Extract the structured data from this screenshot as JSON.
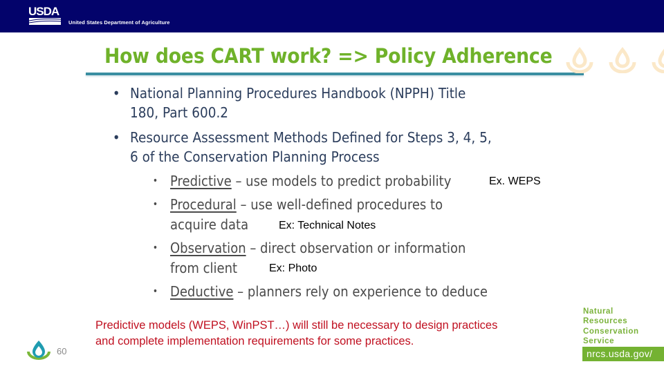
{
  "header": {
    "logo_text": "USDA",
    "department": "United States Department of Agriculture",
    "background_color": "#03036b"
  },
  "slide": {
    "title": "How does CART work? => Policy Adherence",
    "title_color": "#6fb22a",
    "bullets": [
      {
        "lines": [
          "National Planning Procedures Handbook (NPPH) Title",
          "180, Part 600.2"
        ]
      },
      {
        "lines": [
          "Resource Assessment Methods Defined for Steps 3, 4, 5,",
          "6 of the Conservation Planning Process"
        ]
      }
    ],
    "methods": [
      {
        "term": "Predictive",
        "rest_line1": " – use models to predict probability",
        "rest_line2": "",
        "example": "Ex. WEPS"
      },
      {
        "term": "Procedural",
        "rest_line1": " – use well-defined procedures to",
        "rest_line2": "acquire data",
        "example": "Ex: Technical Notes"
      },
      {
        "term": "Observation",
        "rest_line1": " – direct observation or information",
        "rest_line2": "from client",
        "example": "Ex: Photo"
      },
      {
        "term": "Deductive",
        "rest_line1": " – planners rely on experience to deduce",
        "rest_line2": "",
        "example": ""
      }
    ],
    "note_lines": [
      "Predictive models (WEPS, WinPST…) will still be necessary to design practices",
      "and complete implementation requirements for some practices."
    ],
    "note_color": "#c01020"
  },
  "footer": {
    "page_number": "60",
    "agency_lines": [
      "Natural",
      "Resources",
      "Conservation",
      "Service"
    ],
    "url": "nrcs.usda.gov/",
    "accent_color": "#74b232"
  },
  "icons": {
    "usda_logo": "usda-logo-icon",
    "nrcs_drop": "water-drop-icon",
    "bullet": "bullet-dot-icon"
  }
}
